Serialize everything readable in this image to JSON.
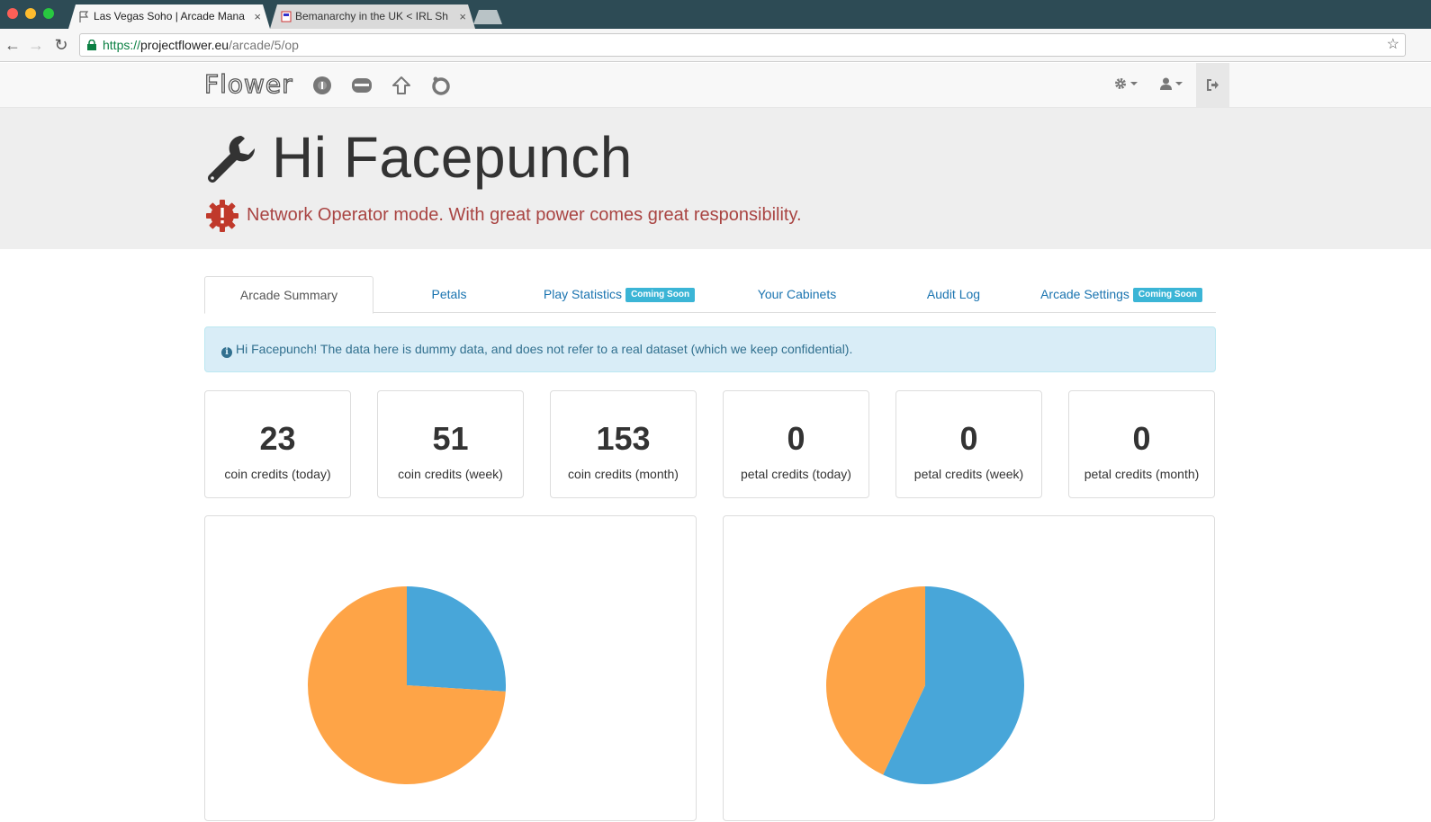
{
  "browser": {
    "tabs": [
      {
        "title": "Las Vegas Soho | Arcade Mana",
        "close": "×"
      },
      {
        "title": "Bemanarchy in the UK < IRL Sh",
        "close": "×"
      }
    ],
    "url_proto": "https://",
    "url_host": "projectflower.eu",
    "url_path": "/arcade/5/op",
    "back": "←",
    "forward": "→",
    "reload": "↻",
    "star": "☆"
  },
  "navbar": {
    "logo": "Flower",
    "icons": [
      "coin-icon",
      "cabinet-icon",
      "upload-icon",
      "ring-icon"
    ],
    "right": [
      "gear-icon",
      "user-icon",
      "logout-icon"
    ]
  },
  "jumbotron": {
    "title": "Hi Facepunch",
    "warning": "Network Operator mode. With great power comes great responsibility."
  },
  "tabs": [
    {
      "label": "Arcade Summary",
      "active": true,
      "badge": ""
    },
    {
      "label": "Petals",
      "active": false,
      "badge": ""
    },
    {
      "label": "Play Statistics",
      "active": false,
      "badge": "Coming Soon"
    },
    {
      "label": "Your Cabinets",
      "active": false,
      "badge": ""
    },
    {
      "label": "Audit Log",
      "active": false,
      "badge": ""
    },
    {
      "label": "Arcade Settings",
      "active": false,
      "badge": "Coming Soon"
    }
  ],
  "alert": {
    "text": "Hi Facepunch! The data here is dummy data, and does not refer to a real dataset (which we keep confidential)."
  },
  "stats": [
    {
      "value": "23",
      "label": "coin credits (today)"
    },
    {
      "value": "51",
      "label": "coin credits (week)"
    },
    {
      "value": "153",
      "label": "coin credits (month)"
    },
    {
      "value": "0",
      "label": "petal credits (today)"
    },
    {
      "value": "0",
      "label": "petal credits (week)"
    },
    {
      "value": "0",
      "label": "petal credits (month)"
    }
  ],
  "chart_data": [
    {
      "type": "pie",
      "values": [
        26,
        74
      ],
      "colors": [
        "#48a6d9",
        "#fea447"
      ]
    },
    {
      "type": "pie",
      "values": [
        57,
        43
      ],
      "colors": [
        "#48a6d9",
        "#fea447"
      ]
    }
  ]
}
